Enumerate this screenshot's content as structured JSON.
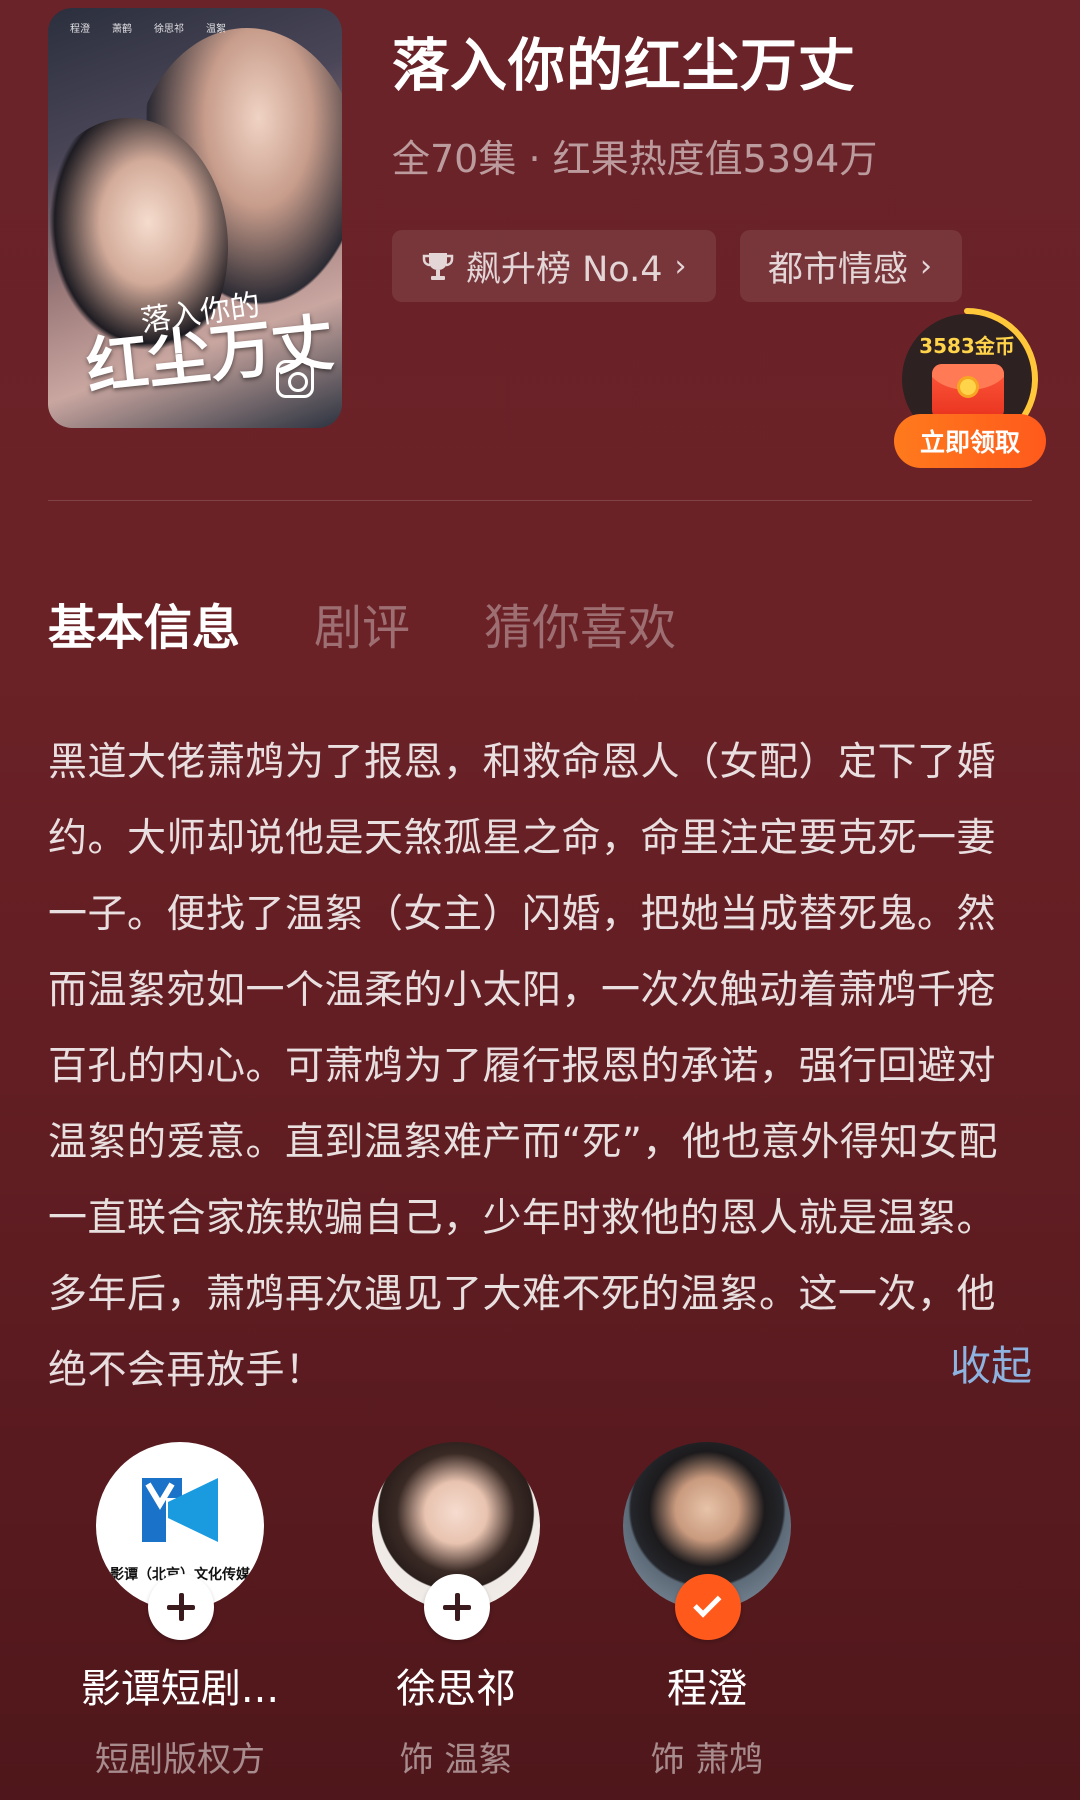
{
  "header": {
    "title": "落入你的红尘万丈",
    "episodes": "全70集",
    "separator": "·",
    "heat": "红果热度值5394万",
    "rank_chip": "飙升榜 No.4",
    "genre_chip": "都市情感",
    "poster": {
      "credits": [
        "程澄",
        "萧鹤",
        "徐思祁",
        "温絮"
      ],
      "title_line1": "落入你的",
      "title_line2": "红尘万丈"
    }
  },
  "rewards": {
    "coins": "3583金币",
    "claim_label": "立即领取"
  },
  "tabs": [
    {
      "label": "基本信息",
      "active": true
    },
    {
      "label": "剧评",
      "active": false
    },
    {
      "label": "猜你喜欢",
      "active": false
    }
  ],
  "synopsis": {
    "text": "黑道大佬萧鸩为了报恩，和救命恩人（女配）定下了婚约。大师却说他是天煞孤星之命，命里注定要克死一妻一子。便找了温絮（女主）闪婚，把她当成替死鬼。然而温絮宛如一个温柔的小太阳，一次次触动着萧鸩千疮百孔的内心。可萧鸩为了履行报恩的承诺，强行回避对温絮的爱意。直到温絮难产而“死”，他也意外得知女配一直联合家族欺骗自己，少年时救他的恩人就是温絮。多年后，萧鸩再次遇见了大难不死的温絮。这一次，他绝不会再放手！",
    "collapse_label": "收起"
  },
  "cast": [
    {
      "name": "影谭短剧...",
      "role": "短剧版权方",
      "logo_text": "影谭（北京）文化传媒",
      "followed": false
    },
    {
      "name": "徐思祁",
      "role": "饰 温絮",
      "followed": false
    },
    {
      "name": "程澄",
      "role": "饰 萧鸩",
      "followed": true
    }
  ],
  "colors": {
    "background": "#6a2328",
    "accent_orange": "#ff5a1c",
    "link_blue": "#8fb3e0",
    "coin_gold": "#ffd34a"
  },
  "icons": [
    "trophy-icon",
    "chevron-right-icon",
    "red-envelope-icon",
    "plus-icon",
    "check-icon"
  ]
}
